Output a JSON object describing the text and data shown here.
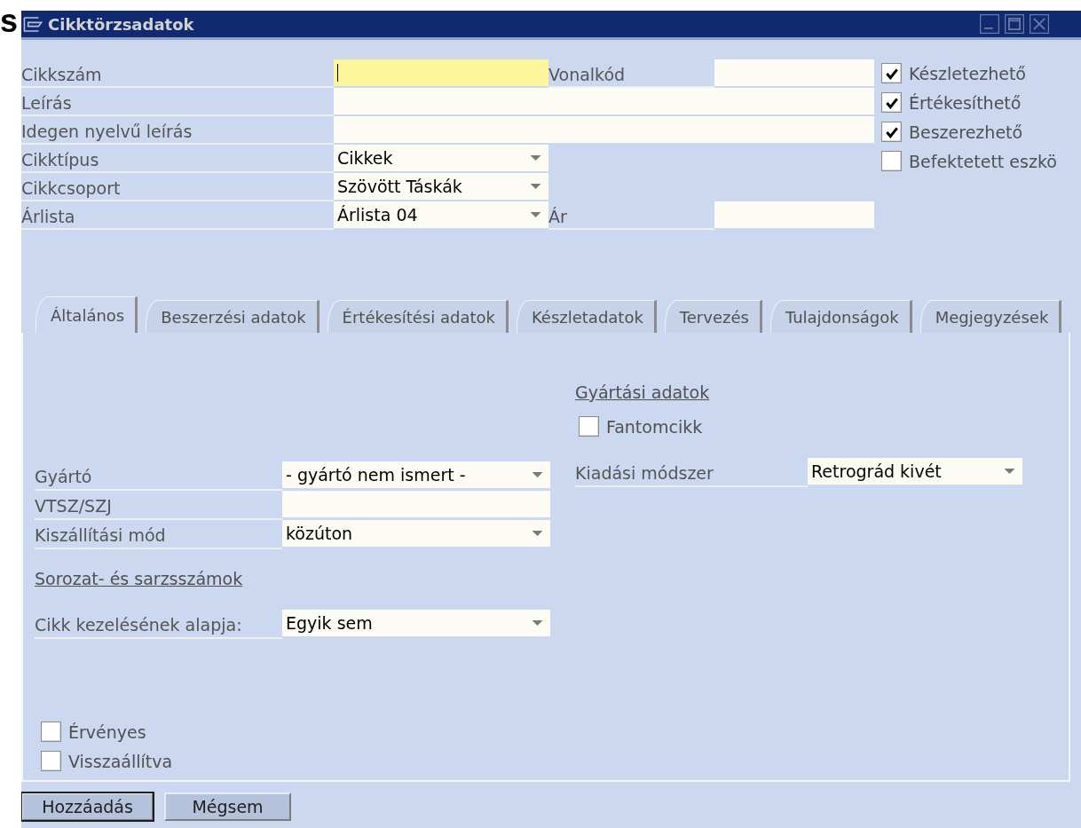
{
  "background_text": "s",
  "window": {
    "title": "Cikktörzsadatok"
  },
  "header_rows": [
    {
      "label": "Cikkszám",
      "kind": "text",
      "focused": true,
      "extra_label": "Vonalkód"
    },
    {
      "label": "Leírás",
      "kind": "wide",
      "focused": false
    },
    {
      "label": "Idegen nyelvű leírás",
      "kind": "wide",
      "focused": false
    },
    {
      "label": "Cikktípus",
      "kind": "dropdown",
      "value": "Cikkek",
      "focused": false
    },
    {
      "label": "Cikkcsoport",
      "kind": "dropdown",
      "value": "Szövött Táskák",
      "focused": false
    },
    {
      "label": "Árlista",
      "kind": "dropdown",
      "value": "Árlista 04",
      "focused": false,
      "extra_label": "Ár"
    }
  ],
  "header_checkboxes": [
    {
      "label": "Készletezhető",
      "checked": true
    },
    {
      "label": "Értékesíthető",
      "checked": true
    },
    {
      "label": "Beszerezhető",
      "checked": true
    },
    {
      "label": "Befektetett eszkö",
      "checked": false
    }
  ],
  "tabs": [
    {
      "label": "Általános",
      "selected": true
    },
    {
      "label": "Beszerzési adatok",
      "selected": false
    },
    {
      "label": "Értékesítési adatok",
      "selected": false
    },
    {
      "label": "Készletadatok",
      "selected": false
    },
    {
      "label": "Tervezés",
      "selected": false
    },
    {
      "label": "Tulajdonságok",
      "selected": false
    },
    {
      "label": "Megjegyzések",
      "selected": false
    }
  ],
  "general": {
    "left_fields": [
      {
        "label": "Gyártó",
        "kind": "dropdown",
        "value": "- gyártó nem ismert -"
      },
      {
        "label": "VTSZ/SZJ",
        "kind": "text"
      },
      {
        "label": "Kiszállítási mód",
        "kind": "dropdown",
        "value": "közúton"
      }
    ],
    "serial_link": "Sorozat- és sarzsszámok",
    "serial_field": {
      "label": "Cikk kezelésének alapja:",
      "kind": "dropdown",
      "value": "Egyik sem"
    },
    "production_heading": "Gyártási adatok",
    "phantom": {
      "label": "Fantomcikk",
      "checked": false
    },
    "issue_field": {
      "label": "Kiadási módszer",
      "kind": "dropdown",
      "value": "Retrográd kivét"
    },
    "bottom_checkboxes": [
      {
        "label": "Érvényes",
        "checked": false
      },
      {
        "label": "Visszaállítva",
        "checked": false
      }
    ]
  },
  "buttons": [
    {
      "label": "Hozzáadás",
      "default": true
    },
    {
      "label": "Mégsem",
      "default": false
    }
  ]
}
